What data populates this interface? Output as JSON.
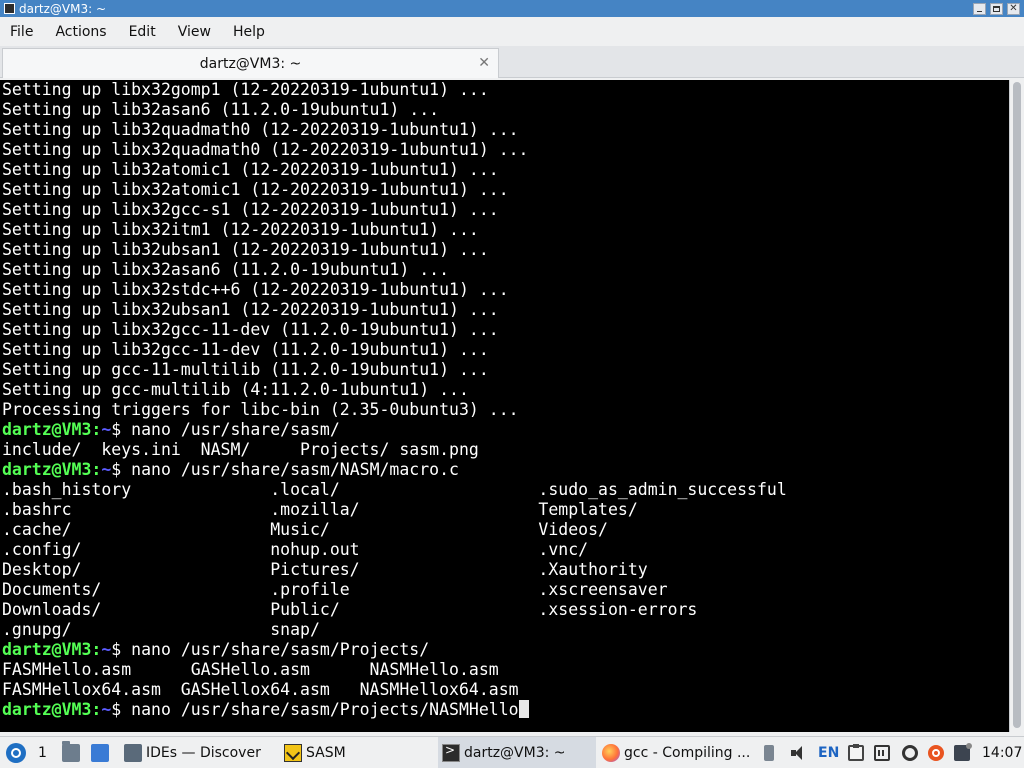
{
  "window": {
    "title": "dartz@VM3: ~",
    "controls": [
      "minimize",
      "maximize",
      "close"
    ],
    "close_glyph": "✕"
  },
  "menubar": {
    "items": [
      "File",
      "Actions",
      "Edit",
      "View",
      "Help"
    ]
  },
  "tabs": [
    {
      "label": "dartz@VM3: ~",
      "close_glyph": "✕",
      "active": true
    }
  ],
  "terminal": {
    "colors": {
      "background": "#000000",
      "text": "#ffffff",
      "prompt_user": "#54ff54",
      "prompt_path": "#5c5cff"
    },
    "prompt_user": "dartz@VM3",
    "prompt_sep": ":",
    "prompt_path": "~",
    "prompt_symbol": "$ ",
    "lines": [
      "Setting up libx32gomp1 (12-20220319-1ubuntu1) ...",
      "Setting up lib32asan6 (11.2.0-19ubuntu1) ...",
      "Setting up lib32quadmath0 (12-20220319-1ubuntu1) ...",
      "Setting up libx32quadmath0 (12-20220319-1ubuntu1) ...",
      "Setting up lib32atomic1 (12-20220319-1ubuntu1) ...",
      "Setting up libx32atomic1 (12-20220319-1ubuntu1) ...",
      "Setting up libx32gcc-s1 (12-20220319-1ubuntu1) ...",
      "Setting up libx32itm1 (12-20220319-1ubuntu1) ...",
      "Setting up lib32ubsan1 (12-20220319-1ubuntu1) ...",
      "Setting up libx32asan6 (11.2.0-19ubuntu1) ...",
      "Setting up libx32stdc++6 (12-20220319-1ubuntu1) ...",
      "Setting up libx32ubsan1 (12-20220319-1ubuntu1) ...",
      "Setting up libx32gcc-11-dev (11.2.0-19ubuntu1) ...",
      "Setting up lib32gcc-11-dev (11.2.0-19ubuntu1) ...",
      "Setting up gcc-11-multilib (11.2.0-19ubuntu1) ...",
      "Setting up gcc-multilib (4:11.2.0-1ubuntu1) ...",
      "Processing triggers for libc-bin (2.35-0ubuntu3) ...",
      {
        "prompt": true,
        "cmd": "nano /usr/share/sasm/"
      },
      "include/  keys.ini  NASM/     Projects/ sasm.png",
      {
        "prompt": true,
        "cmd": "nano /usr/share/sasm/NASM/macro.c"
      },
      ".bash_history              .local/                    .sudo_as_admin_successful",
      ".bashrc                    .mozilla/                  Templates/",
      ".cache/                    Music/                     Videos/",
      ".config/                   nohup.out                  .vnc/",
      "Desktop/                   Pictures/                  .Xauthority",
      "Documents/                 .profile                   .xscreensaver",
      "Downloads/                 Public/                    .xsession-errors",
      ".gnupg/                    snap/",
      {
        "prompt": true,
        "cmd": "nano /usr/share/sasm/Projects/"
      },
      "FASMHello.asm      GASHello.asm      NASMHello.asm",
      "FASMHellox64.asm  GASHellox64.asm   NASMHellox64.asm",
      {
        "prompt": true,
        "cmd": "nano /usr/share/sasm/Projects/NASMHello",
        "cursor": true
      }
    ]
  },
  "taskbar": {
    "desktop_number": "1",
    "tasks": [
      {
        "label": "IDEs — Discover",
        "icon": "discover-icon"
      },
      {
        "label": "SASM",
        "icon": "sasm-icon"
      },
      {
        "label": "dartz@VM3: ~",
        "icon": "terminal-icon",
        "active": true
      },
      {
        "label": "gcc - Compiling ...",
        "icon": "firefox-icon"
      }
    ],
    "tray": {
      "language": "EN",
      "clock": "14:07",
      "icons": [
        "usb-icon",
        "volume-icon",
        "clipboard-icon",
        "network-icon",
        "settings-icon",
        "update-icon",
        "notification-icon"
      ]
    }
  }
}
